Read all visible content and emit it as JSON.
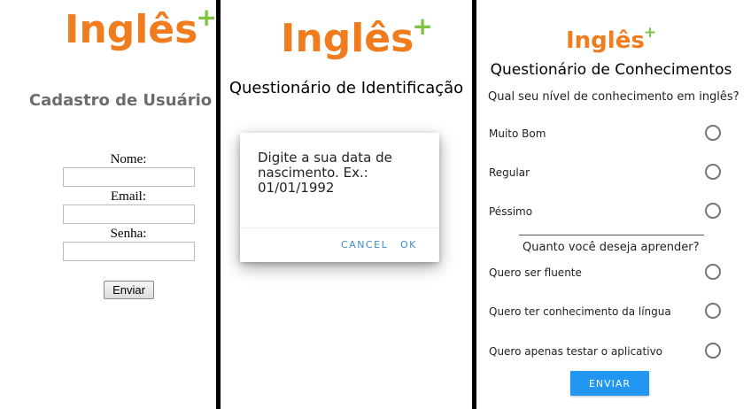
{
  "logo": {
    "word": "Inglês",
    "plus": "+"
  },
  "registration": {
    "title": "Cadastro de Usuário",
    "fields": [
      {
        "label": "Nome:",
        "value": ""
      },
      {
        "label": "Email:",
        "value": ""
      },
      {
        "label": "Senha:",
        "value": ""
      }
    ],
    "submit_label": "Enviar"
  },
  "identification": {
    "title": "Questionário de Identificação",
    "dialog": {
      "message": "Digite a sua data de nascimento. Ex.: 01/01/1992",
      "cancel_label": "CANCEL",
      "ok_label": "OK"
    }
  },
  "knowledge": {
    "title": "Questionário de Conhecimentos",
    "question1": "Qual seu nível de conhecimento em inglês?",
    "options1": [
      "Muito Bom",
      "Regular",
      "Péssimo"
    ],
    "question2": "Quanto você deseja aprender?",
    "options2": [
      "Quero ser fluente",
      "Quero ter conhecimento da língua",
      "Quero apenas testar o aplicativo"
    ],
    "submit_label": "ENVIAR"
  },
  "colors": {
    "logo_orange": "#f07c1e",
    "logo_green": "#7fc241",
    "primary_blue": "#2196f3",
    "dialog_button_blue": "#3f8fd0"
  }
}
